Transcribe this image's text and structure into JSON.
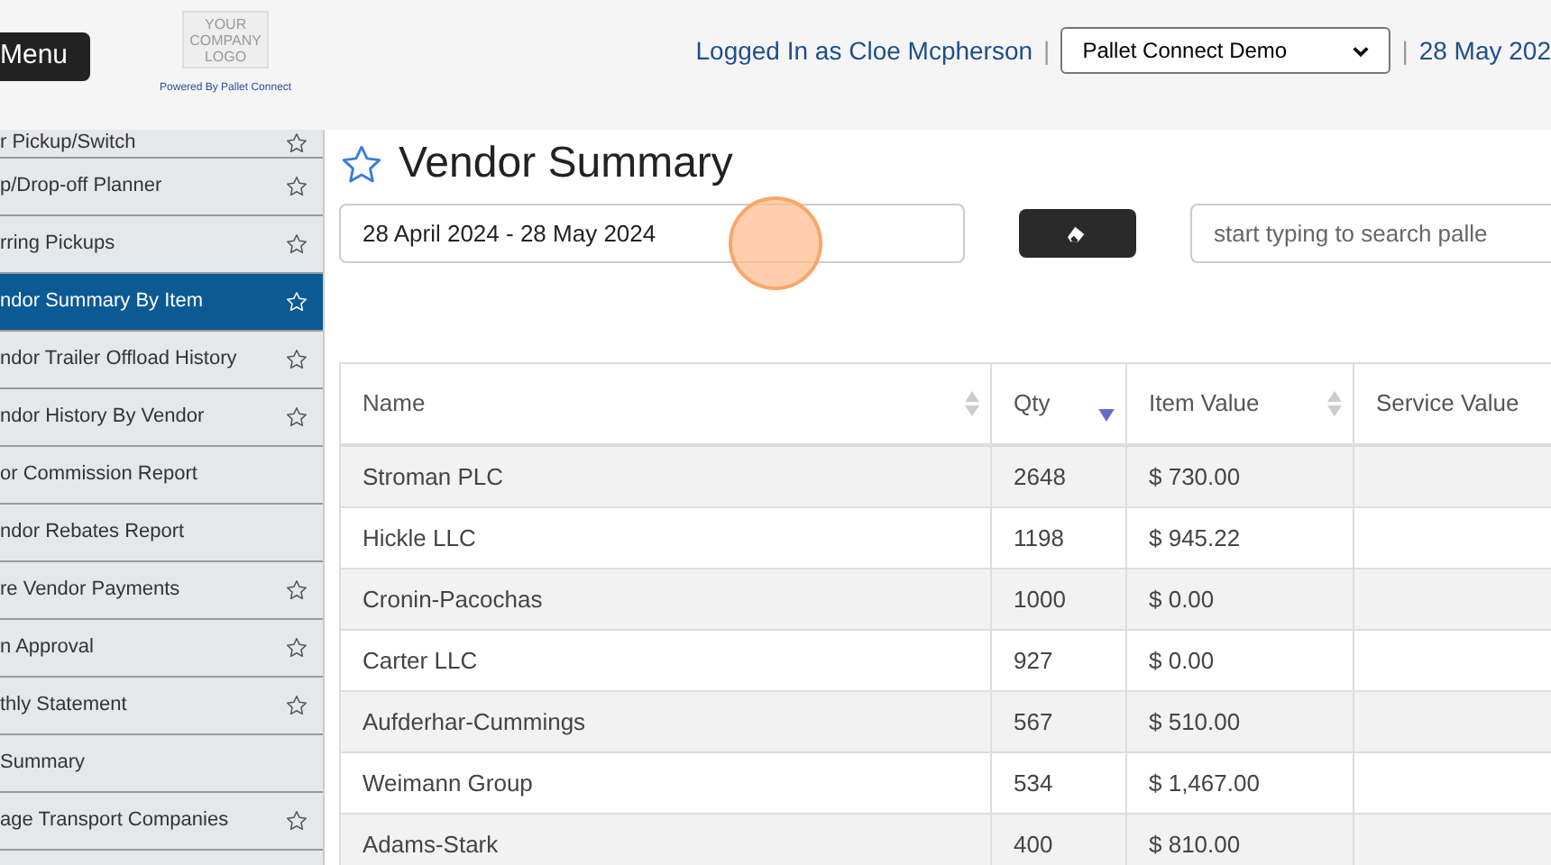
{
  "header": {
    "menu_button": "Menu",
    "logo_text": [
      "YOUR",
      "COMPANY",
      "LOGO"
    ],
    "powered_by": "Powered By Pallet Connect",
    "logged_in": "Logged In as Cloe Mcpherson",
    "separator_1": "|",
    "company_select": "Pallet Connect Demo",
    "separator_2": "|",
    "date": "28 May 202"
  },
  "sidebar": {
    "items": [
      {
        "label": "r Pickup/Switch",
        "star": true,
        "selected": false
      },
      {
        "label": "p/Drop-off Planner",
        "star": true,
        "selected": false
      },
      {
        "label": "rring Pickups",
        "star": true,
        "selected": false
      },
      {
        "label": "ndor Summary By Item",
        "star": true,
        "selected": true
      },
      {
        "label": "ndor Trailer Offload History",
        "star": true,
        "selected": false
      },
      {
        "label": "ndor History By Vendor",
        "star": true,
        "selected": false
      },
      {
        "label": "or Commission Report",
        "star": false,
        "selected": false
      },
      {
        "label": "ndor Rebates Report",
        "star": false,
        "selected": false
      },
      {
        "label": "re Vendor Payments",
        "star": true,
        "selected": false
      },
      {
        "label": "n Approval",
        "star": true,
        "selected": false
      },
      {
        "label": "thly Statement",
        "star": true,
        "selected": false
      },
      {
        "label": "Summary",
        "star": false,
        "selected": false
      },
      {
        "label": "age Transport Companies",
        "star": true,
        "selected": false
      }
    ]
  },
  "page": {
    "title": "Vendor Summary",
    "favorite": false,
    "date_range": "28 April 2024 - 28 May 2024",
    "search_placeholder": "start typing to search palle",
    "click_highlight": true
  },
  "table": {
    "columns": [
      {
        "label": "Name",
        "sorted": false
      },
      {
        "label": "Qty",
        "sorted": true
      },
      {
        "label": "Item Value",
        "sorted": false
      },
      {
        "label": "Service Value"
      }
    ],
    "rows": [
      [
        "Stroman PLC",
        "2648",
        "$ 730.00"
      ],
      [
        "Hickle LLC",
        "1198",
        "$ 945.22"
      ],
      [
        "Cronin-Pacochas",
        "1000",
        "$ 0.00"
      ],
      [
        "Carter LLC",
        "927",
        "$ 0.00"
      ],
      [
        "Aufderhar-Cummings",
        "567",
        "$ 510.00"
      ],
      [
        "Weimann Group",
        "534",
        "$ 1,467.00"
      ],
      [
        "Adams-Stark",
        "400",
        "$ 810.00"
      ]
    ]
  }
}
